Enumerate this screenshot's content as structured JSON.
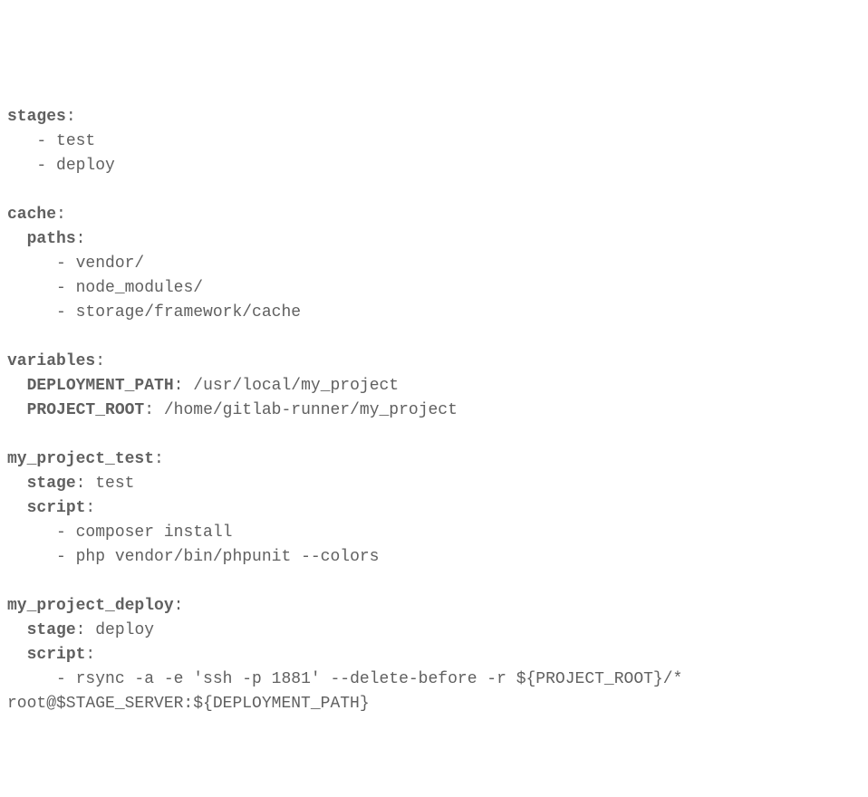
{
  "yaml": {
    "stages_key": "stages",
    "stages_items": [
      "test",
      "deploy"
    ],
    "cache_key": "cache",
    "cache_paths_key": "paths",
    "cache_paths_items": [
      "vendor/",
      "node_modules/",
      "storage/framework/cache"
    ],
    "variables_key": "variables",
    "variables": {
      "deployment_path_key": "DEPLOYMENT_PATH",
      "deployment_path_val": "/usr/local/my_project",
      "project_root_key": "PROJECT_ROOT",
      "project_root_val": "/home/gitlab-runner/my_project"
    },
    "job_test": {
      "name": "my_project_test",
      "stage_key": "stage",
      "stage_val": "test",
      "script_key": "script",
      "script_items": [
        "composer install",
        "php vendor/bin/phpunit --colors"
      ]
    },
    "job_deploy": {
      "name": "my_project_deploy",
      "stage_key": "stage",
      "stage_val": "deploy",
      "script_key": "script",
      "script_line1": "rsync -a -e 'ssh -p 1881' --delete-before -r ${PROJECT_ROOT}/*",
      "script_line2": "root@$STAGE_SERVER:${DEPLOYMENT_PATH}"
    }
  }
}
